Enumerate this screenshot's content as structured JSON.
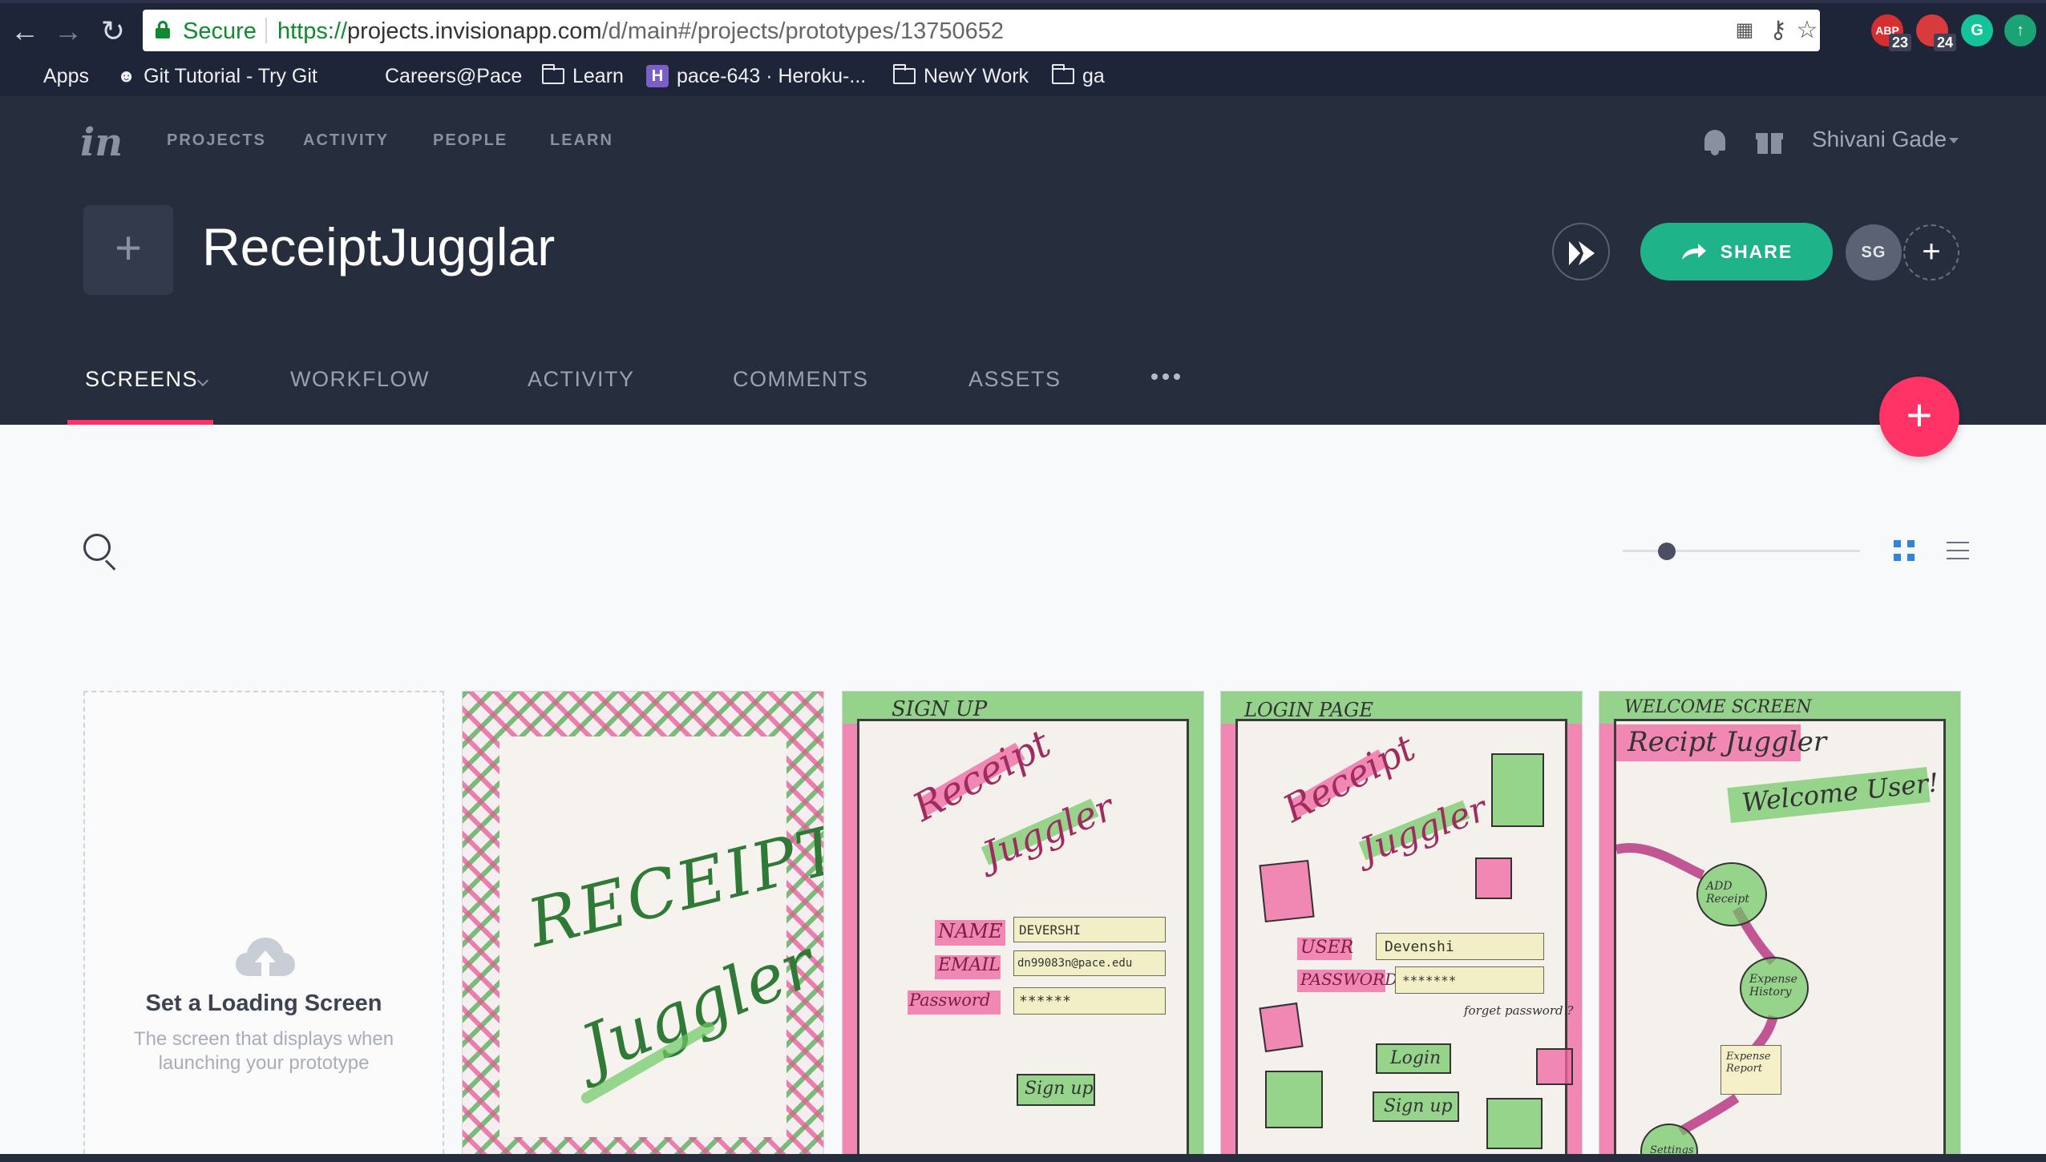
{
  "browser": {
    "secure_label": "Secure",
    "url_scheme": "https://",
    "url_host": "projects.invisionapp.com",
    "url_path": "/d/main#/projects/prototypes/13750652",
    "bookmarks": [
      {
        "label": "Apps",
        "icon": "apps-grid-icon"
      },
      {
        "label": "Git Tutorial - Try Git",
        "icon": "github-cat-icon"
      },
      {
        "label": "Careers@Pace",
        "icon": "none"
      },
      {
        "label": "Learn",
        "icon": "folder-icon"
      },
      {
        "label": "pace-643 · Heroku-...",
        "icon": "heroku-icon"
      },
      {
        "label": "NewY Work",
        "icon": "folder-icon"
      },
      {
        "label": "ga",
        "icon": "folder-icon"
      }
    ],
    "extensions": [
      {
        "name": "abp-extension",
        "badge": "23",
        "color": "#d62f2f",
        "text": "ABP"
      },
      {
        "name": "calendar-extension",
        "badge": "24",
        "color": "#d83b3b",
        "text": ""
      },
      {
        "name": "grammarly-extension",
        "badge": "",
        "color": "#15c39a",
        "text": "G"
      },
      {
        "name": "update-extension",
        "badge": "",
        "color": "#1ba376",
        "text": ""
      }
    ]
  },
  "app": {
    "logo": "in",
    "nav": [
      "PROJECTS",
      "ACTIVITY",
      "PEOPLE",
      "LEARN"
    ],
    "user_name": "Shivani Gade",
    "project_title": "ReceiptJugglar",
    "share_label": "SHARE",
    "avatar_initials": "SG",
    "tabs": [
      "SCREENS",
      "WORKFLOW",
      "ACTIVITY",
      "COMMENTS",
      "ASSETS"
    ],
    "active_tab": "SCREENS",
    "accent_color": "#ff3366",
    "share_color": "#1fb38a"
  },
  "content": {
    "zoom_level": 0.16,
    "view_mode": "grid",
    "loading_card": {
      "title": "Set a Loading Screen",
      "description_line1": "The screen that displays when",
      "description_line2": "launching your prototype"
    },
    "screens": [
      {
        "name": "title-sketch",
        "text_line1": "RECEIPT",
        "text_line2": "Juggler"
      },
      {
        "name": "signup-sketch",
        "heading": "SIGN UP",
        "logo1": "Receipt",
        "logo2": "Juggler",
        "fields": [
          {
            "label": "NAME",
            "value": "DEVERSHI"
          },
          {
            "label": "EMAIL",
            "value": "dn99083n@pace.edu"
          },
          {
            "label": "Password",
            "value": "******"
          }
        ],
        "button": "Sign up"
      },
      {
        "name": "login-sketch",
        "heading": "LOGIN PAGE",
        "logo1": "Receipt",
        "logo2": "Juggler",
        "fields": [
          {
            "label": "USER",
            "value": "Devenshi"
          },
          {
            "label": "PASSWORD",
            "value": "*******"
          }
        ],
        "forgot": "forget password ?",
        "button1": "Login",
        "button2": "Sign up"
      },
      {
        "name": "welcome-sketch",
        "heading": "WELCOME SCREEN",
        "logo": "Recipt Juggler",
        "welcome": "Welcome User!",
        "nodes": [
          "ADD Receipt",
          "Expense History",
          "Expense Report",
          "Settings"
        ]
      }
    ]
  }
}
